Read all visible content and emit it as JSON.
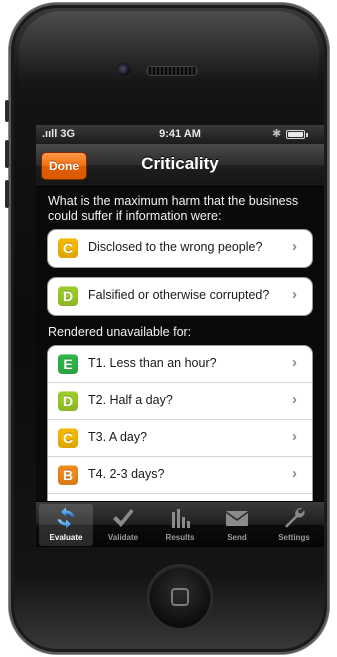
{
  "status_bar": {
    "carrier": ".ııll 3G",
    "time": "9:41 AM",
    "bluetooth": "bluetooth-icon"
  },
  "nav": {
    "done_label": "Done",
    "title": "Criticality"
  },
  "question": "What is the maximum harm that the business could suffer if information were:",
  "impact_items": [
    {
      "badge": "C",
      "label": "Disclosed to the wrong people?",
      "color": "#f5b800"
    },
    {
      "badge": "D",
      "label": "Falsified or otherwise corrupted?",
      "color": "#9ccb2a"
    }
  ],
  "unavailable_label": "Rendered unavailable for:",
  "availability_items": [
    {
      "badge": "E",
      "label": "T1. Less than an hour?",
      "color": "#2fb54a"
    },
    {
      "badge": "D",
      "label": "T2. Half a day?",
      "color": "#9ccb2a"
    },
    {
      "badge": "C",
      "label": "T3. A day?",
      "color": "#f5b800"
    },
    {
      "badge": "B",
      "label": "T4. 2-3 days?",
      "color": "#f08a1c"
    }
  ],
  "tabs": [
    {
      "label": "Evaluate",
      "icon": "refresh-icon",
      "active": true
    },
    {
      "label": "Validate",
      "icon": "checkmark-icon",
      "active": false
    },
    {
      "label": "Results",
      "icon": "bar-chart-icon",
      "active": false
    },
    {
      "label": "Send",
      "icon": "envelope-icon",
      "active": false
    },
    {
      "label": "Settings",
      "icon": "wrench-icon",
      "active": false
    }
  ],
  "colors": {
    "accent": "#f26f12",
    "tab_active_icon": "#3aa0ff"
  }
}
